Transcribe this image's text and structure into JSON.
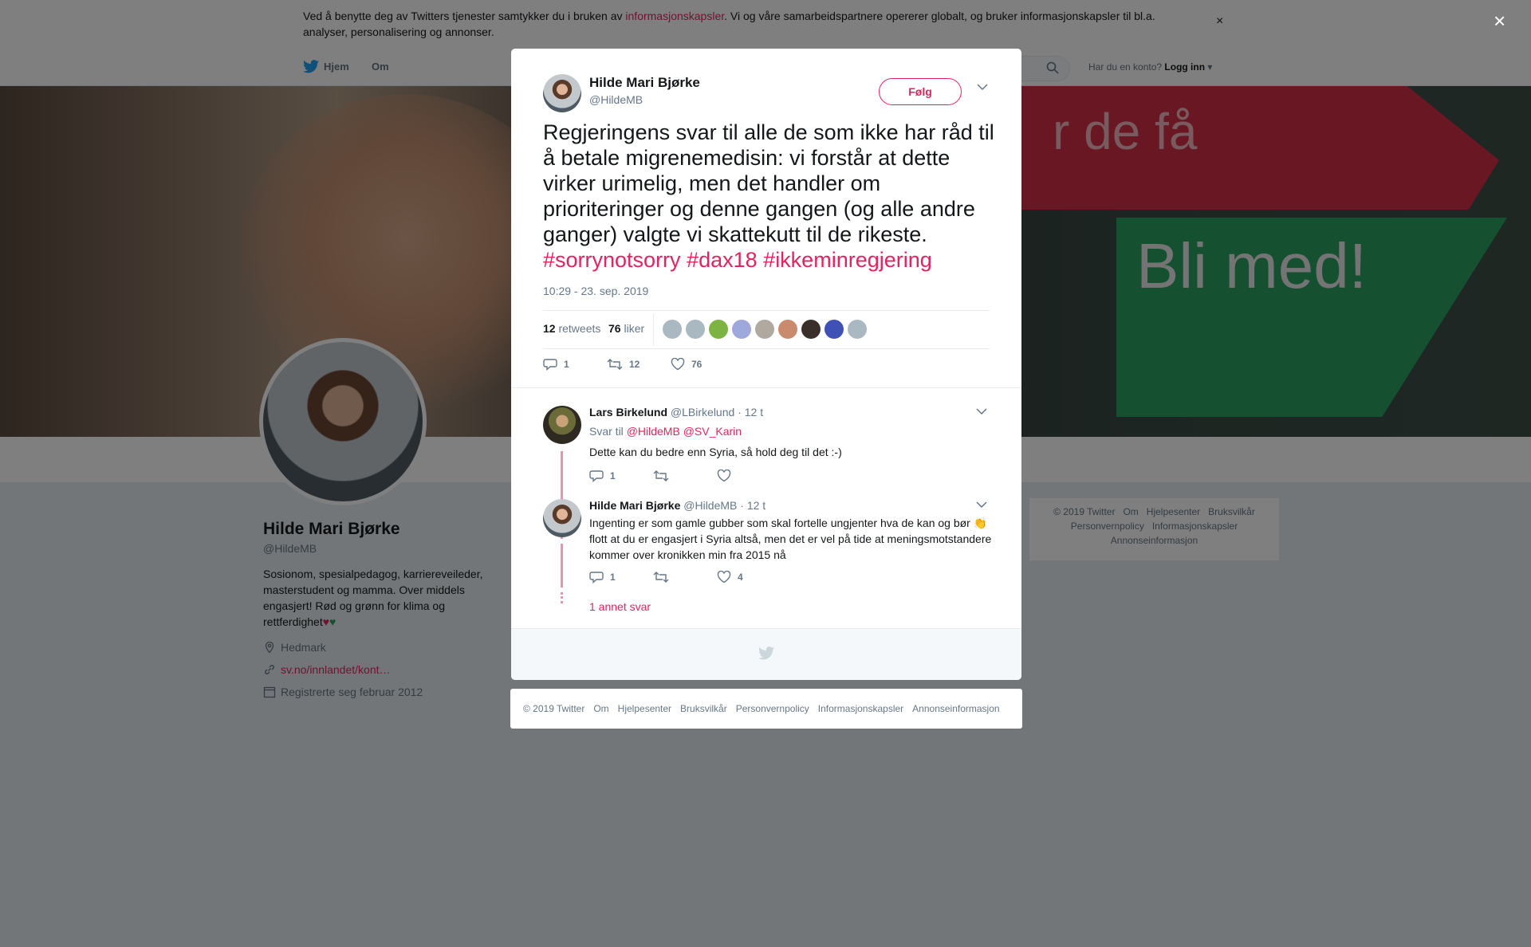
{
  "cookie": {
    "text_before": "Ved å benytte deg av Twitters tjenester samtykker du i bruken av ",
    "link": "informasjonskapsler",
    "text_after": ". Vi og våre samarbeidspartnere opererer globalt, og bruker informasjonskapsler til bl.a. analyser, personalisering og annonser.",
    "close_label": "×"
  },
  "nav": {
    "home": "Hjem",
    "about": "Om",
    "login_prompt": "Har du en konto?",
    "login": "Logg inn"
  },
  "banner": {
    "red_text": "r de få",
    "green_text": "Bli med!"
  },
  "profile": {
    "name": "Hilde Mari Bjørke",
    "handle": "@HildeMB",
    "bio": "Sosionom, spesialpedagog, karriereveileder, masterstudent og mamma. Over middels engasjert! Rød og grønn for klima og rettferdighet",
    "location": "Hedmark",
    "url": "sv.no/innlandet/kont…",
    "joined": "Registrerte seg februar 2012"
  },
  "side_footer": [
    "© 2019 Twitter",
    "Om",
    "Hjelpesenter",
    "Bruksvilkår",
    "Personvernpolicy",
    "Informasjonskapsler",
    "Annonseinformasjon"
  ],
  "overlay_close": "×",
  "tweet": {
    "name": "Hilde Mari Bjørke",
    "handle": "@HildeMB",
    "follow_label": "Følg",
    "text": "Regjeringens svar til alle de som ikke har råd til å betale migrenemedisin: vi forstår at dette virker urimelig, men det handler om prioriteringer og denne gangen (og alle andre ganger) valgte vi skattekutt til de rikeste.",
    "hashtags": [
      "#sorrynotsorry",
      "#dax18",
      "#ikkeminregjering"
    ],
    "timestamp": "10:29 - 23. sep. 2019",
    "retweets_count": "12",
    "retweets_label": "retweets",
    "likes_count": "76",
    "likes_label": "liker",
    "reply_count": "1",
    "retweet_count": "12",
    "like_count": "76"
  },
  "replies": [
    {
      "name": "Lars Birkelund",
      "handle": "@LBirkelund",
      "time": "· 12 t",
      "reply_to_label": "Svar til",
      "reply_to": [
        "@HildeMB",
        "@SV_Karin"
      ],
      "text": "Dette kan du bedre enn Syria, så hold deg til det :-)",
      "reply_count": "1",
      "retweet_count": "",
      "like_count": ""
    },
    {
      "name": "Hilde Mari Bjørke",
      "handle": "@HildeMB",
      "time": "· 12 t",
      "text": "Ingenting er som gamle gubber som skal fortelle ungjenter hva de kan og bør 👏 flott at du er engasjert i Syria altså, men det er vel på tide at meningsmotstandere kommer over kronikken min fra 2015 nå",
      "reply_count": "1",
      "retweet_count": "",
      "like_count": "4"
    }
  ],
  "more_replies": "1 annet svar",
  "modal_footer": [
    "© 2019 Twitter",
    "Om",
    "Hjelpesenter",
    "Bruksvilkår",
    "Personvernpolicy",
    "Informasjonskapsler",
    "Annonseinformasjon"
  ],
  "colors": {
    "accent": "#e0245e",
    "text": "#14171a",
    "muted": "#657786"
  }
}
